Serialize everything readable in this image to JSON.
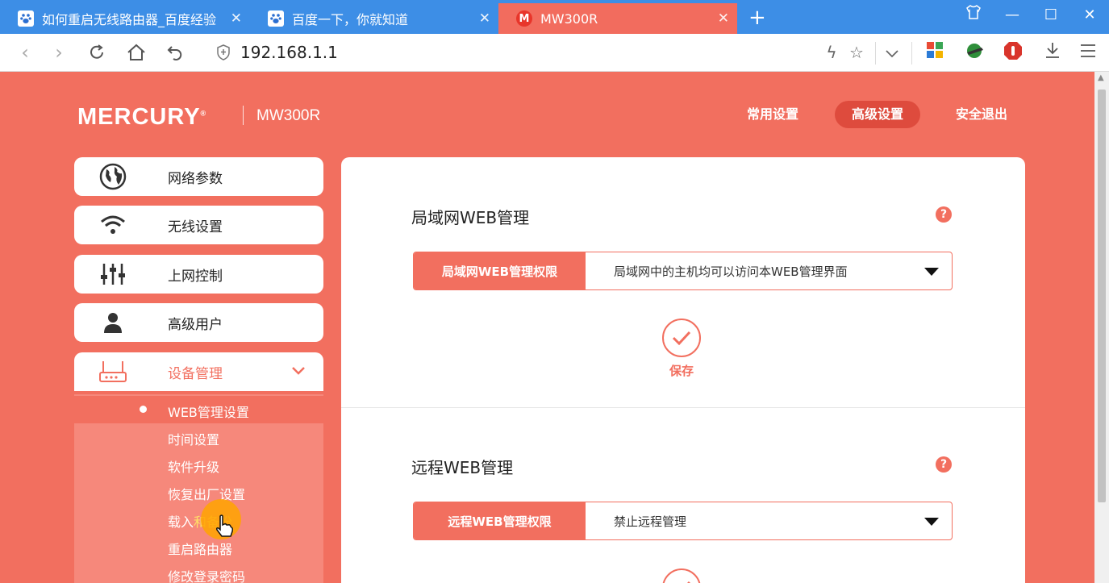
{
  "browser": {
    "tabs": [
      {
        "title": "如何重启无线路由器_百度经验",
        "favicon": "baidu-paw-icon",
        "active": false
      },
      {
        "title": "百度一下，你就知道",
        "favicon": "baidu-paw-icon",
        "active": false
      },
      {
        "title": "MW300R",
        "favicon": "mercury-m-icon",
        "active": true
      }
    ],
    "favicon_m_letter": "M",
    "url": "192.168.1.1",
    "tab_color": "#3d8ee6",
    "active_tab_color": "#f26c5e"
  },
  "header": {
    "brand": "MERCURY",
    "brand_mark": "®",
    "model": "MW300R",
    "nav": [
      {
        "label": "常用设置",
        "active": false
      },
      {
        "label": "高级设置",
        "active": true
      },
      {
        "label": "安全退出",
        "active": false
      }
    ]
  },
  "sidebar": {
    "menu": [
      {
        "label": "网络参数",
        "icon": "globe-icon"
      },
      {
        "label": "无线设置",
        "icon": "wifi-icon"
      },
      {
        "label": "上网控制",
        "icon": "sliders-icon"
      },
      {
        "label": "高级用户",
        "icon": "user-icon"
      },
      {
        "label": "设备管理",
        "icon": "router-icon",
        "open": true
      }
    ],
    "submenu": [
      {
        "label": "WEB管理设置",
        "active": true
      },
      {
        "label": "时间设置"
      },
      {
        "label": "软件升级"
      },
      {
        "label": "恢复出厂设置"
      },
      {
        "label_pre": "载入",
        "label_hl": "和备份"
      },
      {
        "label": "重启路由器"
      },
      {
        "label": "修改登录密码"
      }
    ]
  },
  "content": {
    "lan": {
      "title": "局域网WEB管理",
      "help": "?",
      "field_label": "局域网WEB管理权限",
      "field_value": "局域网中的主机均可以访问本WEB管理界面",
      "save": "保存"
    },
    "remote": {
      "title": "远程WEB管理",
      "help": "?",
      "field_label": "远程WEB管理权限",
      "field_value": "禁止远程管理"
    }
  },
  "colors": {
    "accent": "#f26f5f",
    "accent_dark": "#de4b3d",
    "submenu_bg": "#f6887b"
  }
}
